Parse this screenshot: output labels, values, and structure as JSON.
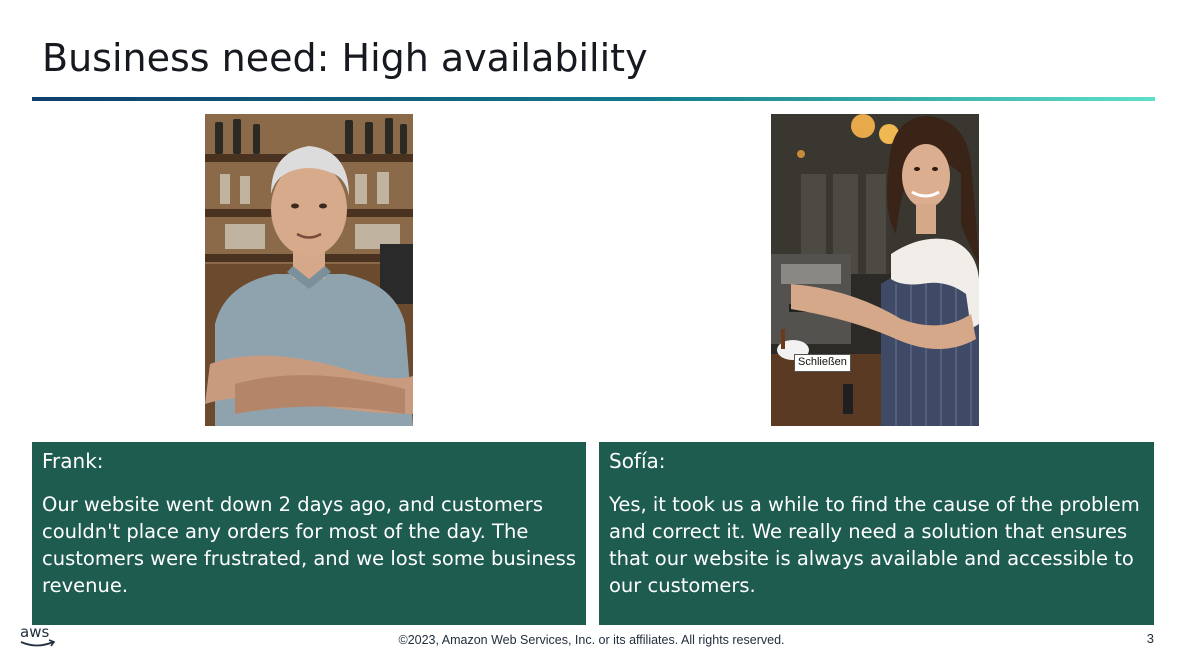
{
  "slide": {
    "title": "Business need: High availability"
  },
  "tooltip": {
    "text": "Schließen"
  },
  "quotes": [
    {
      "speaker": "Frank:",
      "text": "Our website went down 2 days ago, and customers couldn't place any orders for most of the day. The customers were frustrated, and we lost some business revenue."
    },
    {
      "speaker": "Sofía:",
      "text": "Yes, it took us a while to find the cause of the problem and correct it. We really need a solution that ensures that our website is always available and accessible to our customers."
    }
  ],
  "footer": {
    "logo_text": "aws",
    "copyright": "©2023, Amazon Web Services, Inc. or its affiliates. All rights reserved.",
    "page_number": "3"
  },
  "colors": {
    "quote_box": "#1e5c50",
    "title_rule_start": "#0f3f6b",
    "title_rule_end": "#5ee0c8",
    "aws_smile": "#ff9900"
  }
}
